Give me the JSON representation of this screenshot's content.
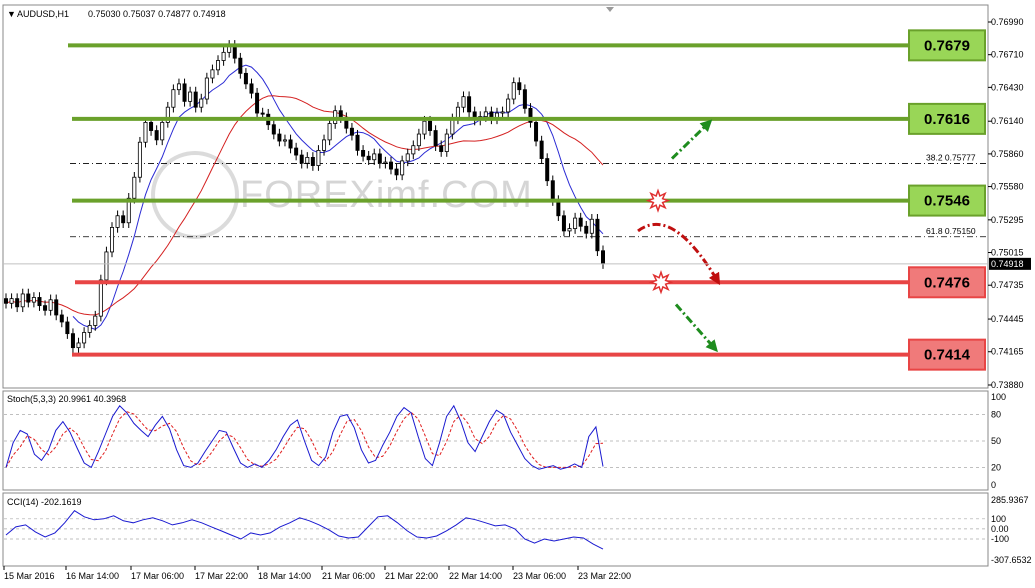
{
  "header": {
    "symbol": "AUDUSD,H1",
    "ohlc": "0.75030 0.75037 0.74877 0.74918"
  },
  "watermark": "FOREXimf.COM",
  "levels": [
    {
      "value": 0.7679,
      "label": "0.7679",
      "type": "resistance",
      "color": "#6aa12b",
      "fill": "#99d657"
    },
    {
      "value": 0.7616,
      "label": "0.7616",
      "type": "resistance",
      "color": "#6aa12b",
      "fill": "#99d657"
    },
    {
      "value": 0.7546,
      "label": "0.7546",
      "type": "resistance",
      "color": "#6aa12b",
      "fill": "#99d657"
    },
    {
      "value": 0.7476,
      "label": "0.7476",
      "type": "support",
      "color": "#e84545",
      "fill": "#f07a7a"
    },
    {
      "value": 0.7414,
      "label": "0.7414",
      "type": "support",
      "color": "#e84545",
      "fill": "#f07a7a"
    }
  ],
  "fibonacci": [
    {
      "ratio": "38.2",
      "value": 0.75777,
      "label": "0.75777"
    },
    {
      "ratio": "61.8",
      "value": 0.7515,
      "label": "0.75150"
    }
  ],
  "current_price": {
    "value": 0.74918,
    "label": "0.74918"
  },
  "price_axis": {
    "ticks": [
      "0.76990",
      "0.76710",
      "0.76430",
      "0.76140",
      "0.75860",
      "0.75580",
      "0.75295",
      "0.75015",
      "0.74735",
      "0.74445",
      "0.74165",
      "0.73880"
    ]
  },
  "stoch_panel": {
    "label": "Stoch(5,3,3) 20.9961 40.3968",
    "ticks": [
      "100",
      "80",
      "50",
      "20",
      "0"
    ]
  },
  "cci_panel": {
    "label": "CCI(14) -202.1619",
    "ticks": [
      "285.9367",
      "100",
      "0.00",
      "-100",
      "-307.6532"
    ]
  },
  "time_axis": {
    "labels": [
      "15 Mar 2016",
      "16 Mar 14:00",
      "17 Mar 06:00",
      "17 Mar 22:00",
      "18 Mar 14:00",
      "21 Mar 06:00",
      "21 Mar 22:00",
      "22 Mar 14:00",
      "23 Mar 06:00",
      "23 Mar 22:00"
    ]
  },
  "colors": {
    "bull_arrow": "#1e8c1e",
    "bear_arrow": "#c01010",
    "ma_fast": "#2b2bd4",
    "ma_slow": "#d42020",
    "stoch_main": "#1a1ad0",
    "stoch_signal": "#e02020",
    "cci": "#1a1ad0"
  },
  "chart_data": {
    "type": "candlestick",
    "title": "AUDUSD,H1",
    "ylim": [
      0.7388,
      0.7699
    ],
    "close_approx": [
      0.7458,
      0.7462,
      0.7455,
      0.7466,
      0.7459,
      0.7463,
      0.7456,
      0.7452,
      0.7461,
      0.7448,
      0.7442,
      0.7432,
      0.742,
      0.7424,
      0.7433,
      0.7439,
      0.7447,
      0.7478,
      0.7502,
      0.7523,
      0.7533,
      0.7527,
      0.7548,
      0.7566,
      0.7596,
      0.7613,
      0.7606,
      0.7598,
      0.7613,
      0.7626,
      0.7641,
      0.7646,
      0.7631,
      0.7639,
      0.7626,
      0.7633,
      0.7651,
      0.7658,
      0.7666,
      0.7673,
      0.7679,
      0.7668,
      0.7655,
      0.7646,
      0.7638,
      0.7621,
      0.762,
      0.7611,
      0.7603,
      0.7597,
      0.7598,
      0.7591,
      0.7585,
      0.7578,
      0.7583,
      0.7576,
      0.7589,
      0.7598,
      0.7612,
      0.7623,
      0.7617,
      0.7608,
      0.7602,
      0.7589,
      0.7584,
      0.7581,
      0.7586,
      0.7578,
      0.7579,
      0.7573,
      0.7568,
      0.758,
      0.7586,
      0.7593,
      0.7603,
      0.7614,
      0.7606,
      0.7593,
      0.7588,
      0.7603,
      0.7616,
      0.7626,
      0.7635,
      0.7622,
      0.7615,
      0.7618,
      0.7622,
      0.7616,
      0.7621,
      0.7622,
      0.7633,
      0.7647,
      0.7641,
      0.7625,
      0.7613,
      0.7597,
      0.7582,
      0.7563,
      0.7546,
      0.7533,
      0.752,
      0.7522,
      0.7531,
      0.7524,
      0.7518,
      0.753,
      0.7503,
      0.7492
    ],
    "stoch": [
      20,
      48,
      62,
      58,
      35,
      28,
      40,
      62,
      72,
      60,
      42,
      25,
      20,
      38,
      58,
      78,
      90,
      82,
      70,
      62,
      55,
      68,
      78,
      64,
      40,
      22,
      20,
      25,
      38,
      50,
      62,
      60,
      42,
      25,
      20,
      24,
      20,
      28,
      40,
      55,
      68,
      74,
      50,
      28,
      22,
      32,
      60,
      78,
      80,
      65,
      40,
      25,
      28,
      45,
      60,
      78,
      88,
      82,
      55,
      30,
      22,
      48,
      78,
      90,
      72,
      48,
      38,
      55,
      72,
      85,
      80,
      60,
      45,
      30,
      22,
      18,
      20,
      22,
      18,
      20,
      24,
      20,
      55,
      66,
      21
    ],
    "cci": [
      -60,
      20,
      40,
      -30,
      -80,
      -40,
      60,
      180,
      120,
      90,
      100,
      130,
      80,
      60,
      90,
      110,
      80,
      40,
      60,
      90,
      60,
      20,
      -20,
      -60,
      -100,
      -40,
      -60,
      -40,
      20,
      60,
      110,
      80,
      40,
      -10,
      -70,
      -90,
      -80,
      20,
      120,
      130,
      60,
      -20,
      -80,
      -90,
      -70,
      -20,
      40,
      110,
      90,
      60,
      30,
      40,
      0,
      -100,
      -140,
      -100,
      -120,
      -100,
      -80,
      -90,
      -150,
      -200
    ]
  }
}
